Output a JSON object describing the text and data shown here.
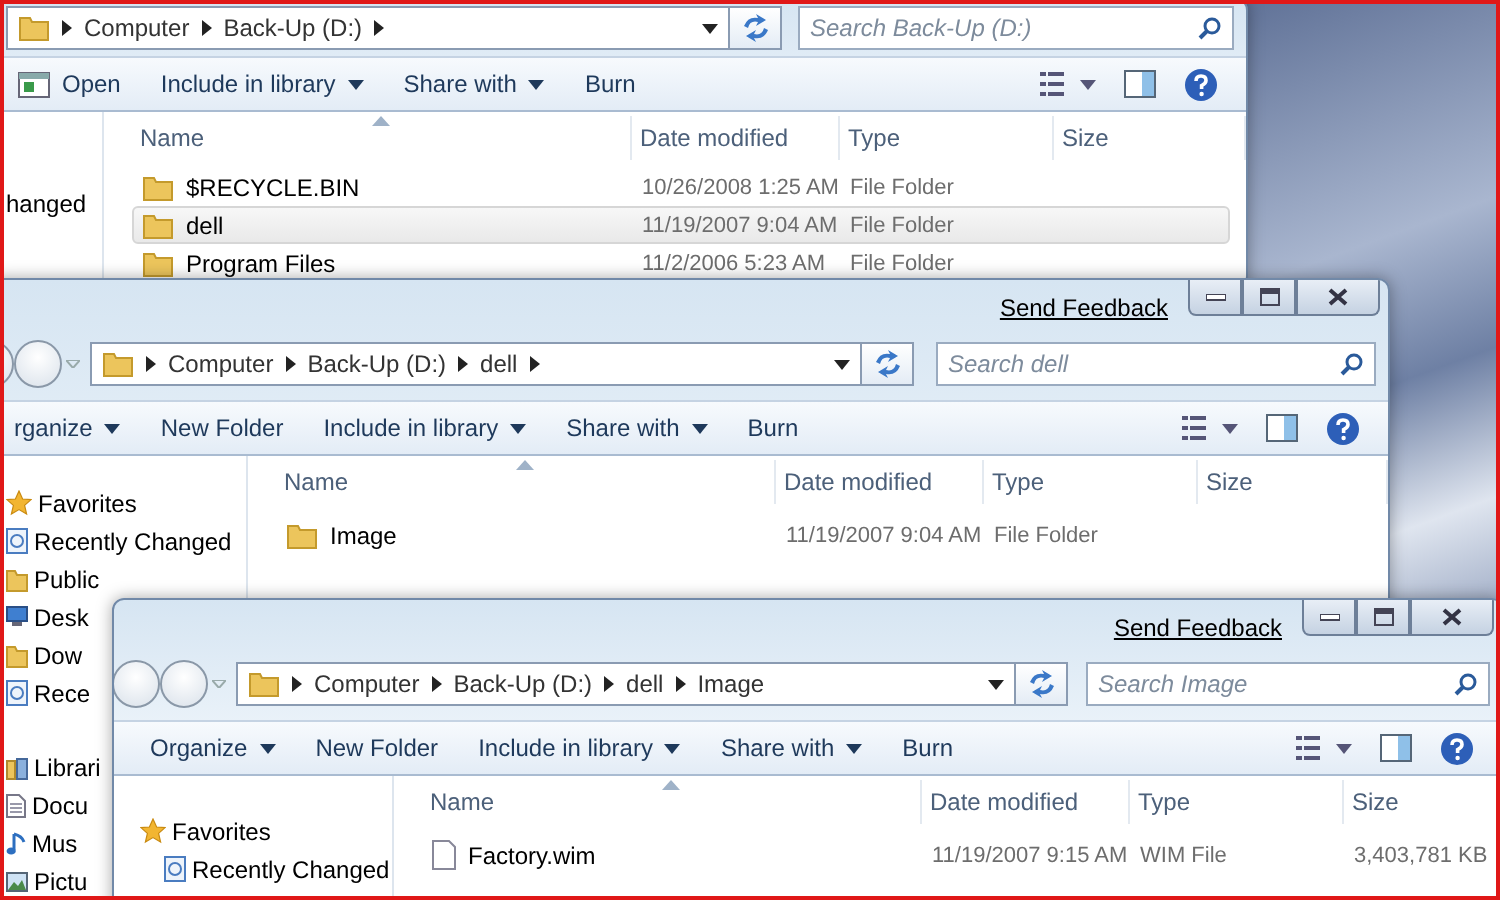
{
  "windows": [
    {
      "breadcrumbs": [
        "Computer",
        "Back-Up (D:)"
      ],
      "trailing_separator": true,
      "search_placeholder": "Search Back-Up (D:)",
      "toolbar": [
        {
          "label": "Open",
          "kind": "open"
        },
        {
          "label": "Include in library",
          "kind": "menu"
        },
        {
          "label": "Share with",
          "kind": "menu"
        },
        {
          "label": "Burn",
          "kind": "button"
        }
      ],
      "nav": [
        {
          "items": [
            {
              "label": "hanged",
              "kind": "plain"
            }
          ]
        }
      ],
      "columns": [
        "Name",
        "Date modified",
        "Type",
        "Size"
      ],
      "rows": [
        {
          "name": "$RECYCLE.BIN",
          "date": "10/26/2008 1:25 AM",
          "type": "File Folder",
          "kind": "folder",
          "selected": false
        },
        {
          "name": "dell",
          "date": "11/19/2007 9:04 AM",
          "type": "File Folder",
          "kind": "folder",
          "selected": true
        },
        {
          "name": "Program Files",
          "date": "11/2/2006 5:23 AM",
          "type": "File Folder",
          "kind": "folder",
          "selected": false
        }
      ]
    },
    {
      "send_feedback": "Send Feedback",
      "breadcrumbs": [
        "Computer",
        "Back-Up (D:)",
        "dell"
      ],
      "trailing_separator": true,
      "search_placeholder": "Search dell",
      "toolbar": [
        {
          "label": "rganize",
          "kind": "menu"
        },
        {
          "label": "New Folder",
          "kind": "button"
        },
        {
          "label": "Include in library",
          "kind": "menu"
        },
        {
          "label": "Share with",
          "kind": "menu"
        },
        {
          "label": "Burn",
          "kind": "button"
        }
      ],
      "nav": [
        {
          "items": [
            {
              "label": "Favorites",
              "kind": "star"
            },
            {
              "label": "Recently Changed",
              "kind": "recent"
            },
            {
              "label": "Public",
              "kind": "folder"
            },
            {
              "label": "Desk",
              "kind": "desktop"
            },
            {
              "label": "Dow",
              "kind": "folder"
            },
            {
              "label": "Rece",
              "kind": "recent"
            }
          ]
        },
        {
          "items": [
            {
              "label": "Librari",
              "kind": "library"
            },
            {
              "label": "Docu",
              "kind": "document"
            },
            {
              "label": "Mus",
              "kind": "music"
            },
            {
              "label": "Pictu",
              "kind": "picture"
            }
          ]
        }
      ],
      "columns": [
        "Name",
        "Date modified",
        "Type",
        "Size"
      ],
      "rows": [
        {
          "name": "Image",
          "date": "11/19/2007 9:04 AM",
          "type": "File Folder",
          "kind": "folder",
          "selected": false
        }
      ]
    },
    {
      "send_feedback": "Send Feedback",
      "breadcrumbs": [
        "Computer",
        "Back-Up (D:)",
        "dell",
        "Image"
      ],
      "trailing_separator": false,
      "search_placeholder": "Search Image",
      "toolbar": [
        {
          "label": "Organize",
          "kind": "menu"
        },
        {
          "label": "New Folder",
          "kind": "button"
        },
        {
          "label": "Include in library",
          "kind": "menu"
        },
        {
          "label": "Share with",
          "kind": "menu"
        },
        {
          "label": "Burn",
          "kind": "button"
        }
      ],
      "nav": [
        {
          "items": [
            {
              "label": "Favorites",
              "kind": "star"
            },
            {
              "label": "Recently Changed",
              "kind": "recent"
            }
          ]
        }
      ],
      "columns": [
        "Name",
        "Date modified",
        "Type",
        "Size"
      ],
      "rows": [
        {
          "name": "Factory.wim",
          "date": "11/19/2007 9:15 AM",
          "type": "WIM File",
          "size": "3,403,781 KB",
          "kind": "file",
          "selected": false
        }
      ]
    }
  ]
}
